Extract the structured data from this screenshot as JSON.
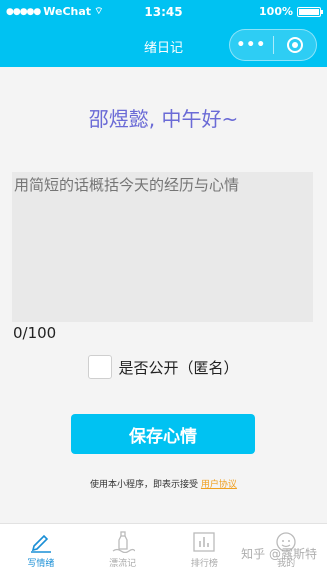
{
  "status_bar": {
    "carrier": "WeChat",
    "time": "13:45",
    "battery": "100%",
    "battery_level": 1.0
  },
  "navbar": {
    "title": "绪日记",
    "more_icon": "more-dots-icon",
    "close_icon": "circle-close-icon"
  },
  "greeting": "邵煜懿, 中午好~",
  "memo": {
    "placeholder": "用简短的话概括今天的经历与心情",
    "value": "",
    "counter": "0/100"
  },
  "public_option": {
    "label": "是否公开（匿名）",
    "checked": false
  },
  "save_button_label": "保存心情",
  "agreement": {
    "text": "使用本小程序，即表示接受 ",
    "link": "用户协议"
  },
  "tabs": [
    {
      "label": "写情绪",
      "icon": "pen-icon",
      "active": true
    },
    {
      "label": "漂流记",
      "icon": "bottle-icon",
      "active": false
    },
    {
      "label": "排行榜",
      "icon": "chart-icon",
      "active": false
    },
    {
      "label": "我的",
      "icon": "face-icon",
      "active": false
    }
  ],
  "watermark": "知乎 @露斯特",
  "colors": {
    "primary": "#00c2f2",
    "greeting": "#6a6ad6",
    "tab_active": "#1a8fd6",
    "link": "#f0a020"
  }
}
